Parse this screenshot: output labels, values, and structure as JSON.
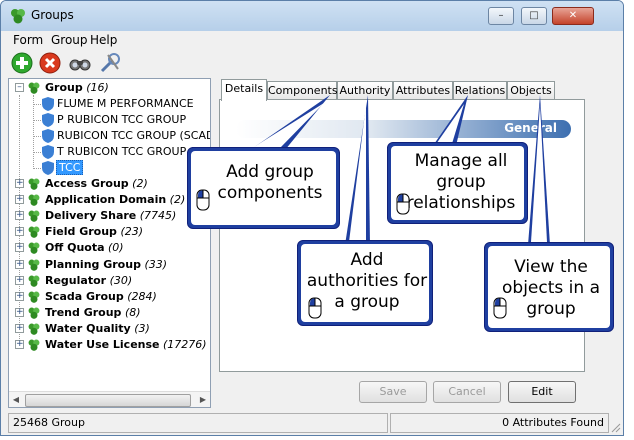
{
  "window": {
    "title": "Groups"
  },
  "menu": [
    "Form",
    "Group",
    "Help"
  ],
  "toolbar": [
    "add-icon",
    "delete-icon",
    "find-icon",
    "tools-icon"
  ],
  "tree": {
    "root": {
      "label": "Group",
      "count": "(16)"
    },
    "children": [
      {
        "label": "FLUME M PERFORMANCE"
      },
      {
        "label": "P RUBICON TCC GROUP"
      },
      {
        "label": "RUBICON TCC GROUP (SCADA)"
      },
      {
        "label": "T RUBICON TCC GROUP (SCADA)"
      },
      {
        "label": "TCC",
        "selected": true
      }
    ],
    "groups": [
      {
        "label": "Access Group",
        "count": "(2)"
      },
      {
        "label": "Application Domain",
        "count": "(2)"
      },
      {
        "label": "Delivery Share",
        "count": "(7745)"
      },
      {
        "label": "Field Group",
        "count": "(23)"
      },
      {
        "label": "Off Quota",
        "count": "(0)"
      },
      {
        "label": "Planning Group",
        "count": "(33)"
      },
      {
        "label": "Regulator",
        "count": "(30)"
      },
      {
        "label": "Scada Group",
        "count": "(284)"
      },
      {
        "label": "Trend Group",
        "count": "(8)"
      },
      {
        "label": "Water Quality",
        "count": "(3)"
      },
      {
        "label": "Water Use License",
        "count": "(17276)"
      }
    ]
  },
  "tabs": [
    "Details",
    "Components",
    "Authority",
    "Attributes",
    "Relations",
    "Objects"
  ],
  "active_tab": "Details",
  "section_title": "General",
  "buttons": {
    "save": "Save",
    "cancel": "Cancel",
    "edit": "Edit"
  },
  "status": {
    "left": "25468 Group",
    "right": "0 Attributes Found"
  },
  "callouts": {
    "components": "Add group\ncomponents",
    "authority": "Add\nauthorities for\na group",
    "relations": "Manage all\ngroup\nrelationships",
    "objects": "View the\nobjects in a\ngroup"
  },
  "colors": {
    "callout_border": "#1f3fa0",
    "tree_icon_green": "#3a9a2a",
    "item_icon_blue": "#3b7fd4",
    "selected_bg": "#3399ff"
  }
}
